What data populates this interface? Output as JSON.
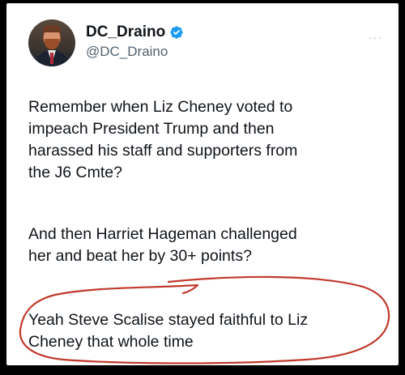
{
  "tweet": {
    "display_name": "DC_Draino",
    "handle": "@DC_Draino",
    "more_label": "···",
    "paragraphs": [
      "Remember when Liz Cheney voted to\nimpeach President Trump and then\nharassed his staff and supporters from\nthe J6 Cmte?",
      "And then Harriet Hageman challenged\nher and beat her by 30+ points?",
      "Yeah Steve Scalise stayed faithful to Liz\nCheney that whole time"
    ]
  },
  "colors": {
    "verified_badge": "#1d9bf0",
    "annotation_ink": "#c0392b",
    "text": "#0f1419",
    "handle": "#536471"
  },
  "icons": {
    "verified": "verified-badge-icon",
    "more": "more-options-icon"
  }
}
